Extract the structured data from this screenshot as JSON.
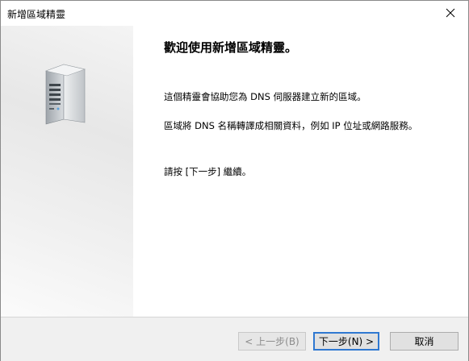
{
  "window": {
    "title": "新增區域精靈"
  },
  "content": {
    "heading": "歡迎使用新增區域精靈。",
    "paragraph1": "這個精靈會協助您為 DNS 伺服器建立新的區域。",
    "paragraph2": "區域將 DNS 名稱轉譯成相關資料，例如 IP 位址或網路服務。",
    "paragraph3": "請按 [下一步] 繼續。"
  },
  "buttons": {
    "back": "< 上一步(B)",
    "next": "下一步(N) >",
    "cancel": "取消"
  },
  "icons": {
    "close": "close-icon",
    "illustration": "server-icon"
  },
  "colors": {
    "default_button_border": "#2f78d1",
    "side_panel": "#ececec",
    "footer": "#f0f0f0"
  }
}
